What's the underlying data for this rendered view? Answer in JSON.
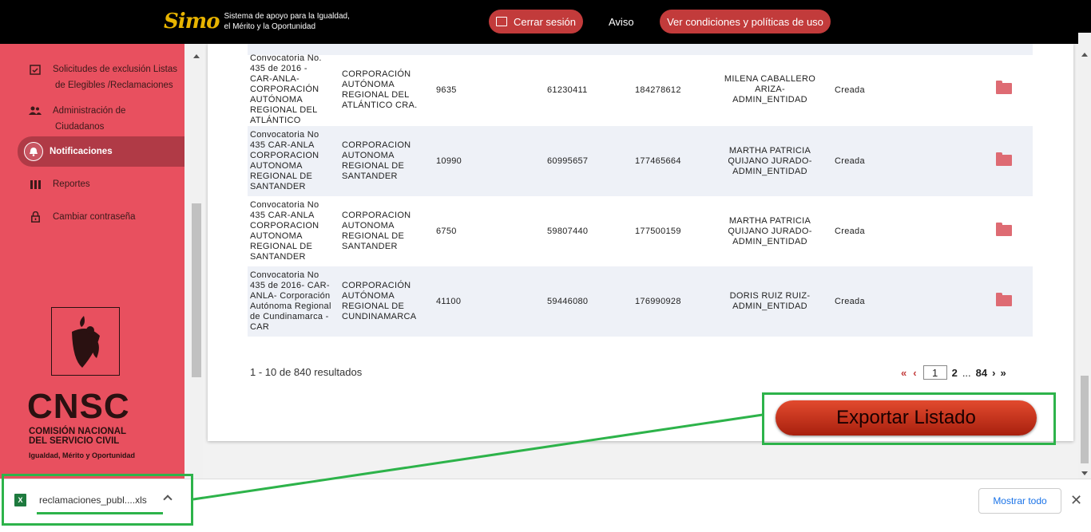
{
  "header": {
    "logo_mark": "Simo",
    "logo_line1": "Sistema de apoyo para la Igualdad,",
    "logo_line2": "el Mérito y la Oportunidad",
    "logout": "Cerrar sesión",
    "aviso": "Aviso",
    "terms": "Ver condiciones y políticas de uso"
  },
  "sidebar": {
    "items": [
      {
        "label_1": "Solicitudes de exclusión Listas",
        "label_2": "de Elegibles /Reclamaciones",
        "icon": "calendar-check-icon"
      },
      {
        "label_1": "Administración de",
        "label_2": "Ciudadanos",
        "icon": "users-icon"
      },
      {
        "label_1": "Notificaciones",
        "label_2": "",
        "icon": "bell-icon"
      },
      {
        "label_1": "Reportes",
        "label_2": "",
        "icon": "columns-icon"
      },
      {
        "label_1": "Cambiar contraseña",
        "label_2": "",
        "icon": "lock-icon"
      }
    ],
    "org_name": "CNSC",
    "org_sub_1": "COMISIÓN NACIONAL",
    "org_sub_2": "DEL SERVICIO CIVIL",
    "org_tagline": "Igualdad, Mérito y Oportunidad"
  },
  "table": {
    "rows": [
      {
        "convocatoria": [
          "Convocatoria No.",
          "435 de 2016 -",
          "CAR-ANLA-",
          "CORPORACIÓN",
          "AUTÓNOMA",
          "REGIONAL DEL",
          "ATLÁNTICO"
        ],
        "entidad": [
          "CORPORACIÓN",
          "AUTÓNOMA",
          "REGIONAL DEL",
          "ATLÁNTICO CRA."
        ],
        "n1": "9635",
        "n2": "61230411",
        "n3": "184278612",
        "usuario": [
          "MILENA CABALLERO",
          "ARIZA-",
          "ADMIN_ENTIDAD"
        ],
        "estado": "Creada"
      },
      {
        "convocatoria": [
          "Convocatoria No",
          "435 CAR-ANLA",
          "CORPORACION",
          "AUTONOMA",
          "REGIONAL DE",
          "SANTANDER"
        ],
        "entidad": [
          "CORPORACION",
          "AUTONOMA",
          "REGIONAL DE",
          "SANTANDER"
        ],
        "n1": "10990",
        "n2": "60995657",
        "n3": "177465664",
        "usuario": [
          "MARTHA PATRICIA",
          "QUIJANO JURADO-",
          "ADMIN_ENTIDAD"
        ],
        "estado": "Creada"
      },
      {
        "convocatoria": [
          "Convocatoria No",
          "435 CAR-ANLA",
          "CORPORACION",
          "AUTONOMA",
          "REGIONAL DE",
          "SANTANDER"
        ],
        "entidad": [
          "CORPORACION",
          "AUTONOMA",
          "REGIONAL DE",
          "SANTANDER"
        ],
        "n1": "6750",
        "n2": "59807440",
        "n3": "177500159",
        "usuario": [
          "MARTHA PATRICIA",
          "QUIJANO JURADO-",
          "ADMIN_ENTIDAD"
        ],
        "estado": "Creada"
      },
      {
        "convocatoria": [
          "Convocatoria No",
          "435 de 2016- CAR-",
          "ANLA- Corporación",
          "Autónoma Regional",
          "de Cundinamarca -",
          "CAR"
        ],
        "entidad": [
          "CORPORACIÓN",
          "AUTÓNOMA",
          "REGIONAL DE",
          "CUNDINAMARCA"
        ],
        "n1": "41100",
        "n2": "59446080",
        "n3": "176990928",
        "usuario": [
          "DORIS RUIZ RUIZ-",
          "ADMIN_ENTIDAD"
        ],
        "estado": "Creada"
      }
    ]
  },
  "pagination": {
    "results": "1 - 10 de 840 resultados",
    "first": "«",
    "prev": "‹",
    "current": "1",
    "page2": "2",
    "ellipsis": "...",
    "last_page": "84",
    "next": "›",
    "last": "»"
  },
  "export": {
    "label": "Exportar Listado"
  },
  "download_bar": {
    "file_name": "reclamaciones_publ....xls",
    "show_all": "Mostrar todo",
    "close": "✕",
    "file_icon": "excel-icon"
  },
  "colors": {
    "sidebar": "#e8505f",
    "accent": "#c23b3b",
    "highlight": "#2db34a"
  }
}
